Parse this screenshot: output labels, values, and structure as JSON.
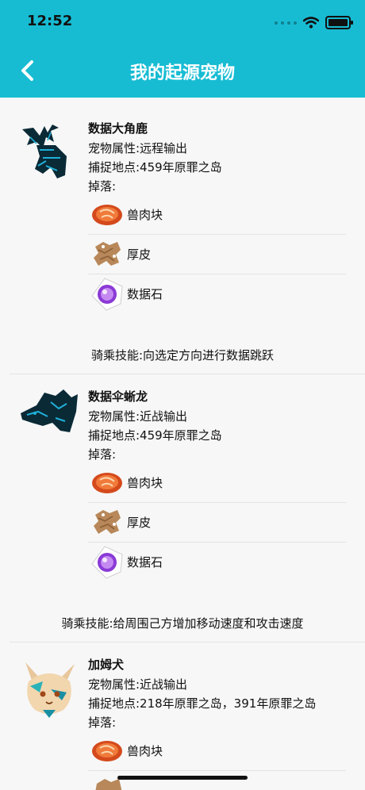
{
  "status_bar": {
    "time": "12:52"
  },
  "nav": {
    "title": "我的起源宠物"
  },
  "colors": {
    "header": "#17bcd3",
    "background": "#f7f7f7"
  },
  "pets": [
    {
      "name": "数据大角鹿",
      "attribute": "宠物属性:远程输出",
      "location": "捕捉地点:459年原罪之岛",
      "drops_label": "掉落:",
      "drops": [
        {
          "label": "兽肉块",
          "icon": "meat-icon"
        },
        {
          "label": "厚皮",
          "icon": "hide-icon"
        },
        {
          "label": "数据石",
          "icon": "data-stone-icon"
        }
      ],
      "skill": "骑乘技能:向选定方向进行数据跳跃"
    },
    {
      "name": "数据伞蜥龙",
      "attribute": "宠物属性:近战输出",
      "location": "捕捉地点:459年原罪之岛",
      "drops_label": "掉落:",
      "drops": [
        {
          "label": "兽肉块",
          "icon": "meat-icon"
        },
        {
          "label": "厚皮",
          "icon": "hide-icon"
        },
        {
          "label": "数据石",
          "icon": "data-stone-icon"
        }
      ],
      "skill": "骑乘技能:给周围己方增加移动速度和攻击速度"
    },
    {
      "name": "加姆犬",
      "attribute": "宠物属性:近战输出",
      "location": "捕捉地点:218年原罪之岛，391年原罪之岛",
      "drops_label": "掉落:",
      "drops": [
        {
          "label": "兽肉块",
          "icon": "meat-icon"
        }
      ]
    }
  ]
}
